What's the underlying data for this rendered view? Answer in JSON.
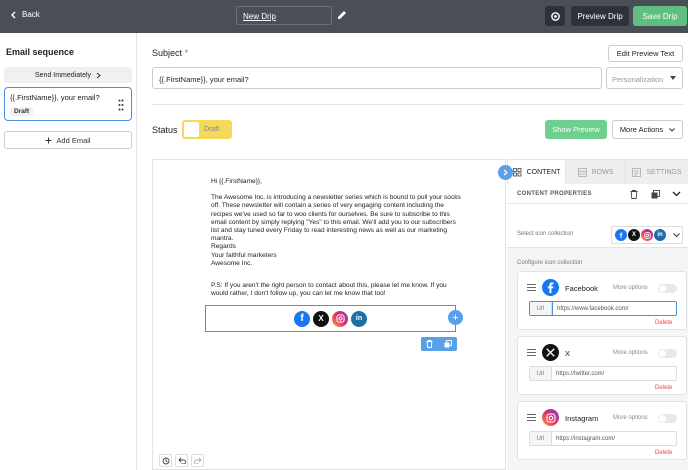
{
  "topbar": {
    "back_label": "Back",
    "drip_name": "New Drip",
    "preview_label": "Preview Drip",
    "save_label": "Save Drip"
  },
  "sidebar": {
    "title": "Email sequence",
    "send_label": "Send Immediately",
    "emails": [
      {
        "subject": "{{.FirstName}}, your email?",
        "status": "Draft"
      }
    ],
    "add_email_label": "Add Email"
  },
  "subject": {
    "label": "Subject",
    "required_mark": "*",
    "value": "{{.FirstName}}, your email?",
    "edit_preview_label": "Edit Preview Text",
    "personalization_placeholder": "Personalization"
  },
  "status": {
    "label": "Status",
    "value": "Draft",
    "show_preview_label": "Show Preview",
    "more_actions_label": "More Actions"
  },
  "email_body": {
    "greeting": "Hi {{.FirstName}},",
    "paragraph": "The Awesome Inc. is introducing a newsletter series which is bound to pull your socks off. These newsletter will contain a series of very engaging content including the recipes we've used so far to woo clients for ourselves. Be sure to subscribe to this email content by simply replying \"Yes\" to this email. We'll add you to our subscribers list and stay tuned every Friday to read interesting news as well as our marketing mantra.",
    "regards": "Regards",
    "signoff": "Your faithful marketers",
    "company": "Awesome Inc.",
    "ps": "P.S: If you aren't the right person to contact about this, please let me know. If you would rather, I don't follow up, you can let me know that too!",
    "social_icons": [
      "facebook-icon",
      "x-icon",
      "instagram-icon",
      "linkedin-icon"
    ]
  },
  "right_panel": {
    "tabs": [
      {
        "label": "CONTENT",
        "active": true
      },
      {
        "label": "ROWS",
        "active": false
      },
      {
        "label": "SETTINGS",
        "active": false
      }
    ],
    "section_title": "CONTENT PROPERTIES",
    "icon_collection_label": "Select icon collection",
    "configure_label": "Configure icon collection",
    "networks": [
      {
        "name": "Facebook",
        "more_options": "More options",
        "url_label": "Url",
        "url": "https://www.facebook.com/",
        "delete_label": "Delete"
      },
      {
        "name": "X",
        "more_options": "More options",
        "url_label": "Url",
        "url": "https://twitter.com/",
        "delete_label": "Delete"
      },
      {
        "name": "Instagram",
        "more_options": "More options",
        "url_label": "Url",
        "url": "https://instagram.com/",
        "delete_label": "Delete"
      }
    ]
  },
  "colors": {
    "topbar": "#4a4f57",
    "save": "#5fbf7e",
    "accent": "#4a90d9",
    "draft_toggle": "#f6d85a",
    "delete": "#e04a4a"
  }
}
